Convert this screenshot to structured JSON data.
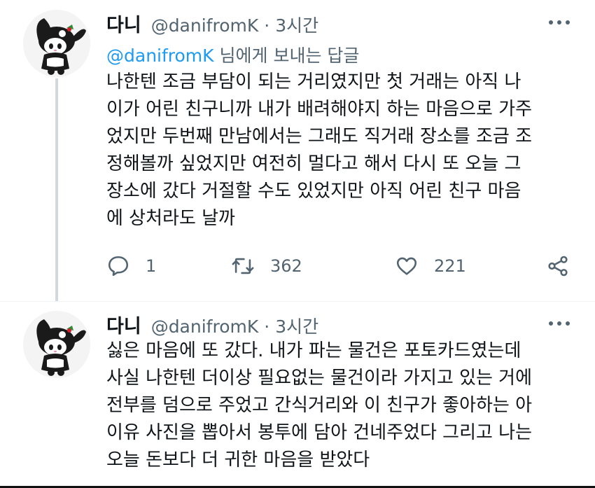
{
  "tweets": [
    {
      "author_name": "다니",
      "author_handle": "@danifromK",
      "separator": "·",
      "time": "3시간",
      "reply_mention": "@danifromK",
      "reply_suffix": " 님에게 보내는 답글",
      "lines": [
        "나한텐 조금 부담이 되는 거리였지만 첫 거래는 아직 나",
        "이가 어린 친구니까 내가 배려해야지 하는 마음으로 가주",
        "었지만 두번째 만남에서는 그래도 직거래 장소를 조금 조",
        "정해볼까 싶었지만 여전히 멀다고 해서 다시 또 오늘 그",
        "장소에 갔다 거절할 수도 있었지만 아직 어린 친구 마음",
        "에 상처라도 날까"
      ],
      "reply_count": "1",
      "retweet_count": "362",
      "like_count": "221"
    },
    {
      "author_name": "다니",
      "author_handle": "@danifromK",
      "separator": "·",
      "time": "3시간",
      "lines": [
        "싫은 마음에 또 갔다. 내가 파는 물건은 포토카드였는데",
        "사실 나한텐 더이상 필요없는 물건이라 가지고 있는 거에",
        "전부를 덤으로 주었고 간식거리와 이 친구가 좋아하는 아",
        "이유 사진을 뽑아서 봉투에 담아 건네주었다 그리고 나는",
        "오늘 돈보다 더 귀한  마음을 받았다"
      ]
    }
  ],
  "icons": {
    "reply": "speech-bubble-icon",
    "retweet": "retweet-icon",
    "like": "heart-icon",
    "share": "share-icon",
    "more": "more-dots-icon",
    "avatar": "kuromi-avatar"
  },
  "colors": {
    "text": "#0f1419",
    "secondary": "#536471",
    "link": "#1d9bf0",
    "thread_line": "#cfd9de"
  }
}
